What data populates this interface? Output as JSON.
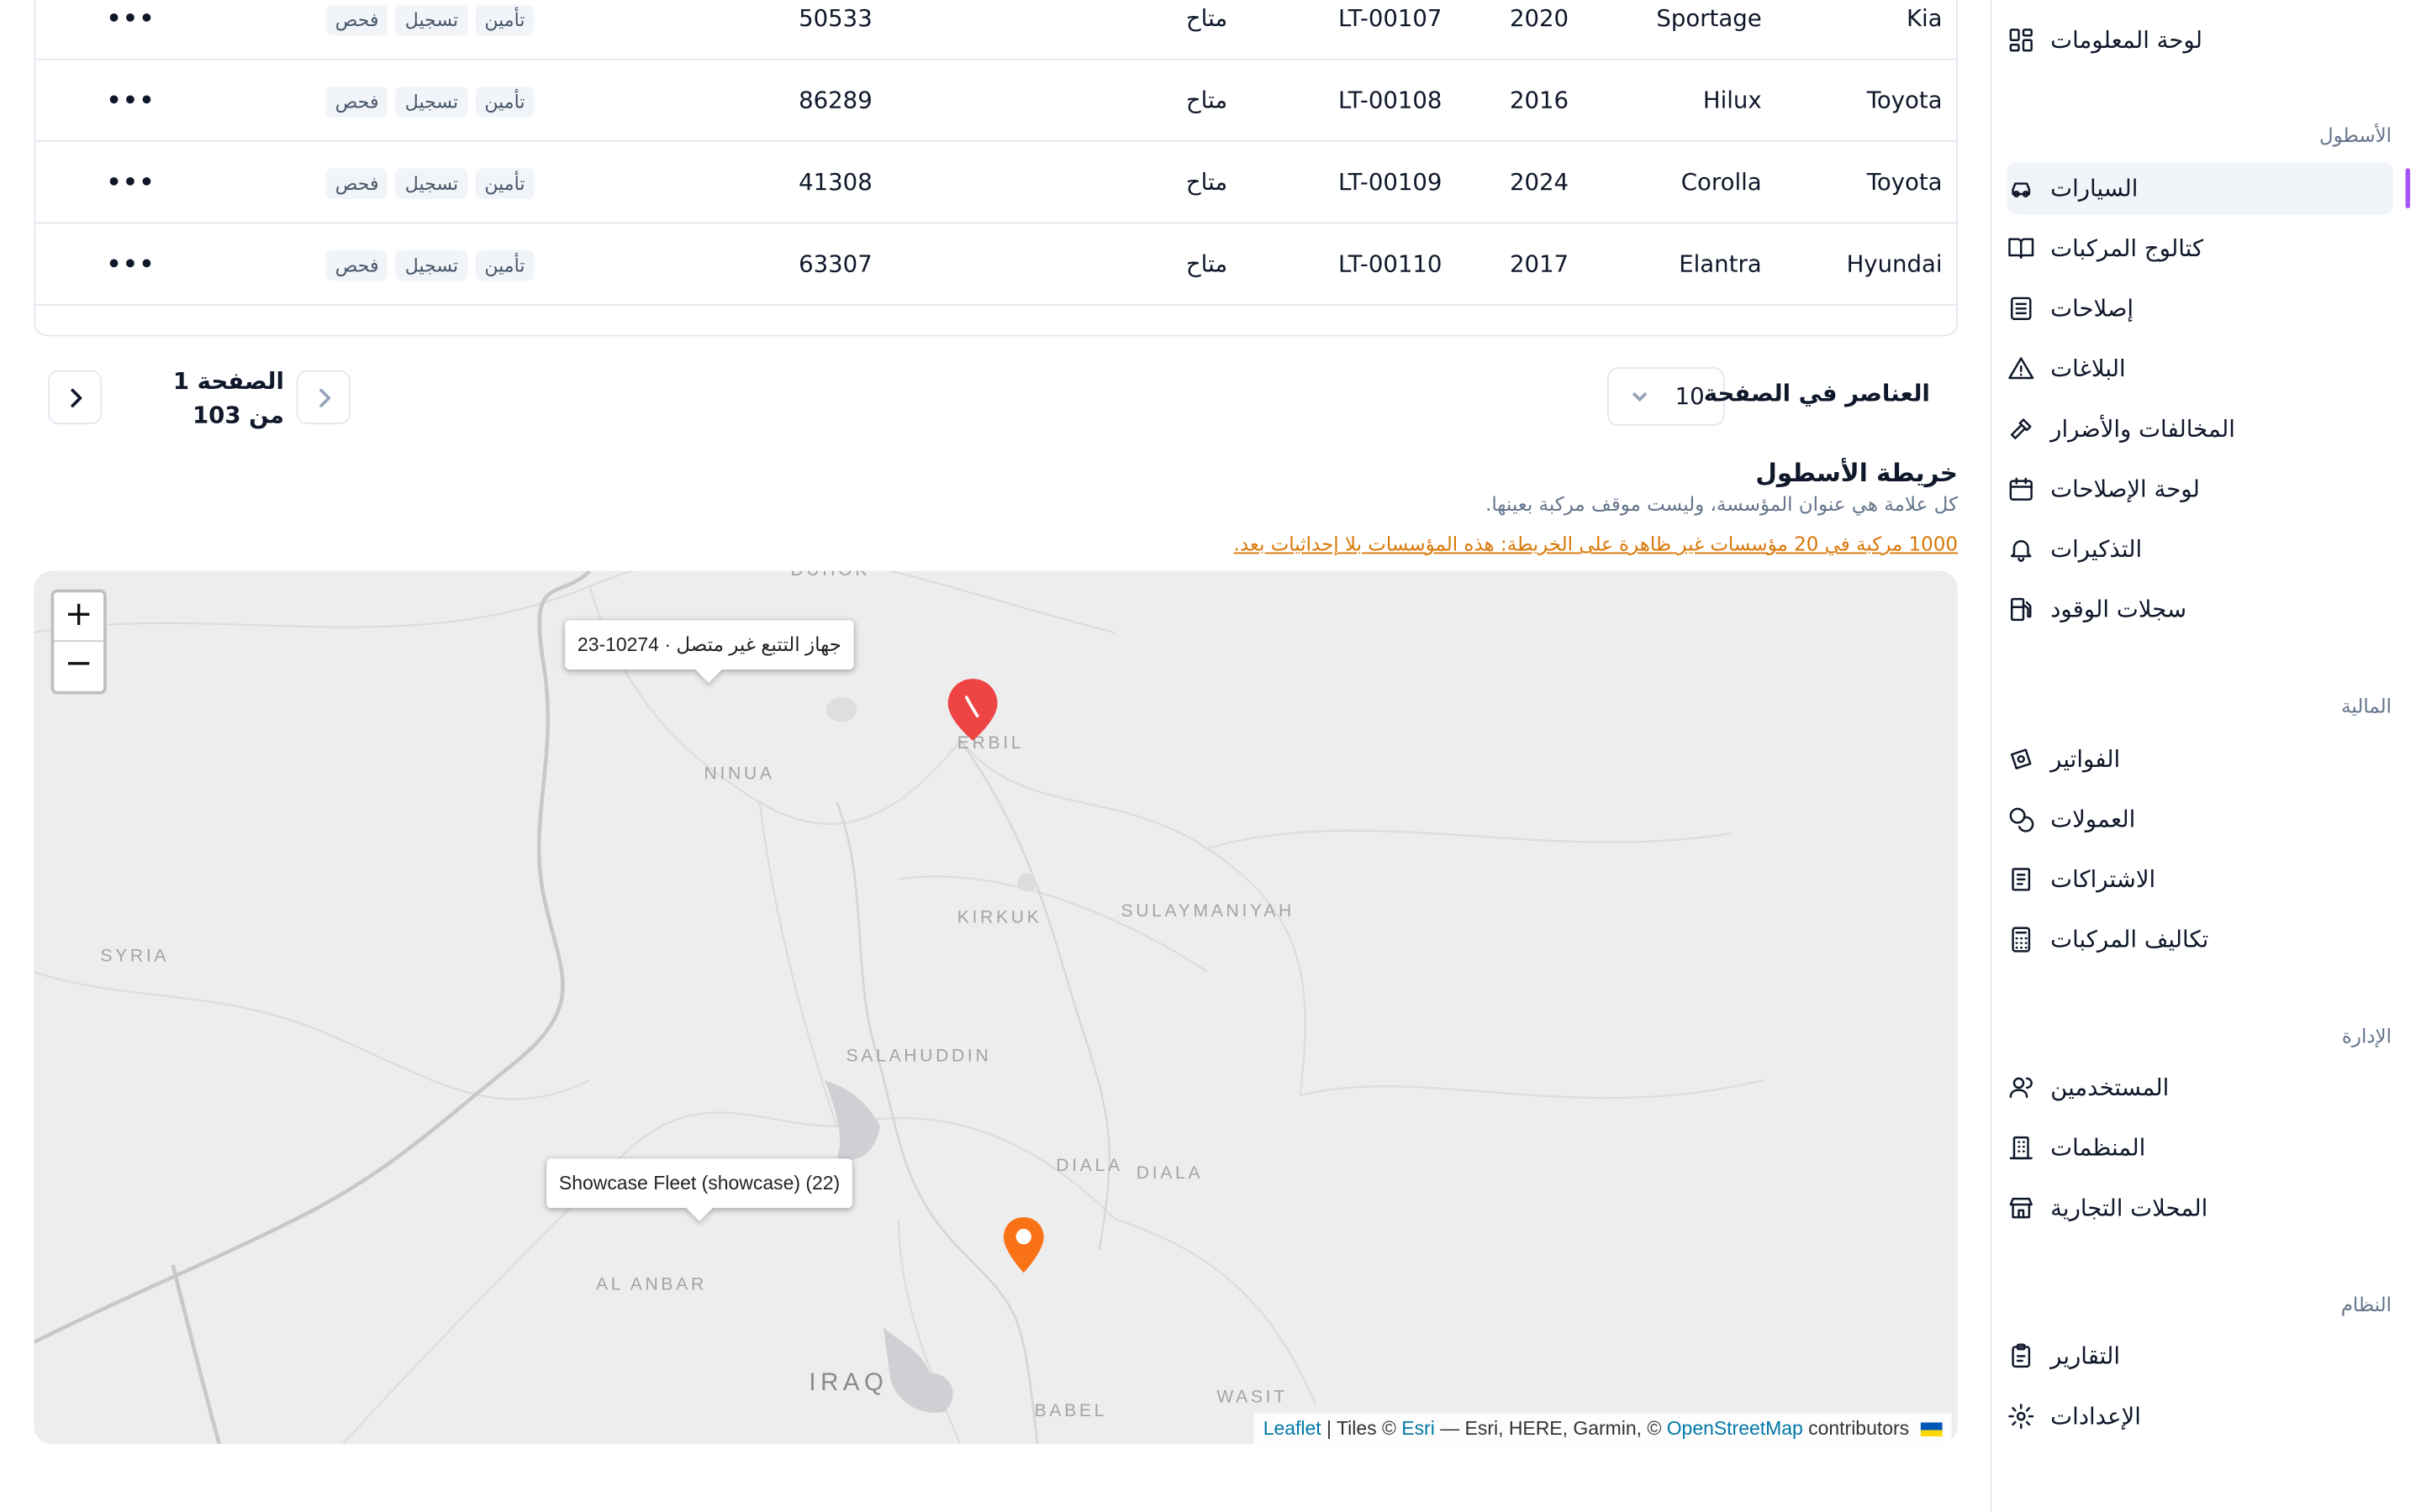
{
  "sidebar": {
    "items": [
      {
        "label": "لوحة المعلومات",
        "icon": "dashboard-icon"
      },
      {
        "group": "الأسطول"
      },
      {
        "label": "السيارات",
        "icon": "car-icon",
        "active": true
      },
      {
        "label": "كتالوج المركبات",
        "icon": "book-open-icon"
      },
      {
        "label": "إصلاحات",
        "icon": "wrench-box-icon"
      },
      {
        "label": "البلاغات",
        "icon": "alert-triangle-icon"
      },
      {
        "label": "المخالفات والأضرار",
        "icon": "hammer-icon"
      },
      {
        "label": "لوحة الإصلاحات",
        "icon": "calendar-icon"
      },
      {
        "label": "التذكيرات",
        "icon": "bell-icon"
      },
      {
        "label": "سجلات الوقود",
        "icon": "fuel-icon"
      },
      {
        "group": "المالية"
      },
      {
        "label": "الفواتير",
        "icon": "banknote-icon"
      },
      {
        "label": "العمولات",
        "icon": "coins-icon"
      },
      {
        "label": "الاشتراكات",
        "icon": "receipt-icon"
      },
      {
        "label": "تكاليف المركبات",
        "icon": "calculator-icon"
      },
      {
        "group": "الإدارة"
      },
      {
        "label": "المستخدمين",
        "icon": "users-icon"
      },
      {
        "label": "المنظمات",
        "icon": "building-icon"
      },
      {
        "label": "المحلات التجارية",
        "icon": "store-icon"
      },
      {
        "group": "النظام"
      },
      {
        "label": "التقارير",
        "icon": "clipboard-icon"
      },
      {
        "label": "الإعدادات",
        "icon": "gear-icon"
      }
    ]
  },
  "table": {
    "rows": [
      {
        "make": "Kia",
        "model": "Sportage",
        "year": "2020",
        "plate": "LT-00107",
        "status": "متاح",
        "mileage": "50533",
        "docs": [
          "تأمين",
          "تسجيل",
          "فحص"
        ]
      },
      {
        "make": "Toyota",
        "model": "Hilux",
        "year": "2016",
        "plate": "LT-00108",
        "status": "متاح",
        "mileage": "86289",
        "docs": [
          "تأمين",
          "تسجيل",
          "فحص"
        ]
      },
      {
        "make": "Toyota",
        "model": "Corolla",
        "year": "2024",
        "plate": "LT-00109",
        "status": "متاح",
        "mileage": "41308",
        "docs": [
          "تأمين",
          "تسجيل",
          "فحص"
        ]
      },
      {
        "make": "Hyundai",
        "model": "Elantra",
        "year": "2017",
        "plate": "LT-00110",
        "status": "متاح",
        "mileage": "63307",
        "docs": [
          "تأمين",
          "تسجيل",
          "فحص"
        ]
      }
    ],
    "more_label": "•••"
  },
  "pagination": {
    "page_label": "الصفحة 1 من 103",
    "per_page_label": "العناصر في الصفحة",
    "per_page_value": "10"
  },
  "map_section": {
    "title": "خريطة الأسطول",
    "subtitle": "كل علامة هي عنوان المؤسسة، وليست موقف مركبة بعينها.",
    "warning": "1000 مركبة في 20 مؤسسات غير ظاهرة على الخريطة: هذه المؤسسات بلا إحداثيات بعد.",
    "zoom_in": "+",
    "zoom_out": "−",
    "places": [
      "DUHOK",
      "ERBIL",
      "NINUA",
      "KIRKUK",
      "SULAYMANIYAH",
      "SYRIA",
      "SALAHUDDIN",
      "DIALA",
      "DIALA",
      "AL ANBAR",
      "IRAQ",
      "BABEL",
      "WASIT"
    ],
    "tooltips": [
      "23-10274 · جهاز التتبع غير متصل",
      "Showcase Fleet (showcase) (22)"
    ],
    "markers": [
      {
        "color": "#ef4444",
        "name": "map-pin-red"
      },
      {
        "color": "#f97316",
        "name": "map-pin-orange"
      }
    ],
    "attribution": {
      "leaflet": "Leaflet",
      "sep1": " | Tiles © ",
      "esri": "Esri",
      "mid": " — Esri, HERE, Garmin, © ",
      "osm": "OpenStreetMap",
      "end": " contributors"
    }
  },
  "colors": {
    "accent": "#a855f7",
    "warning": "#d97706",
    "link": "#0078a8"
  }
}
